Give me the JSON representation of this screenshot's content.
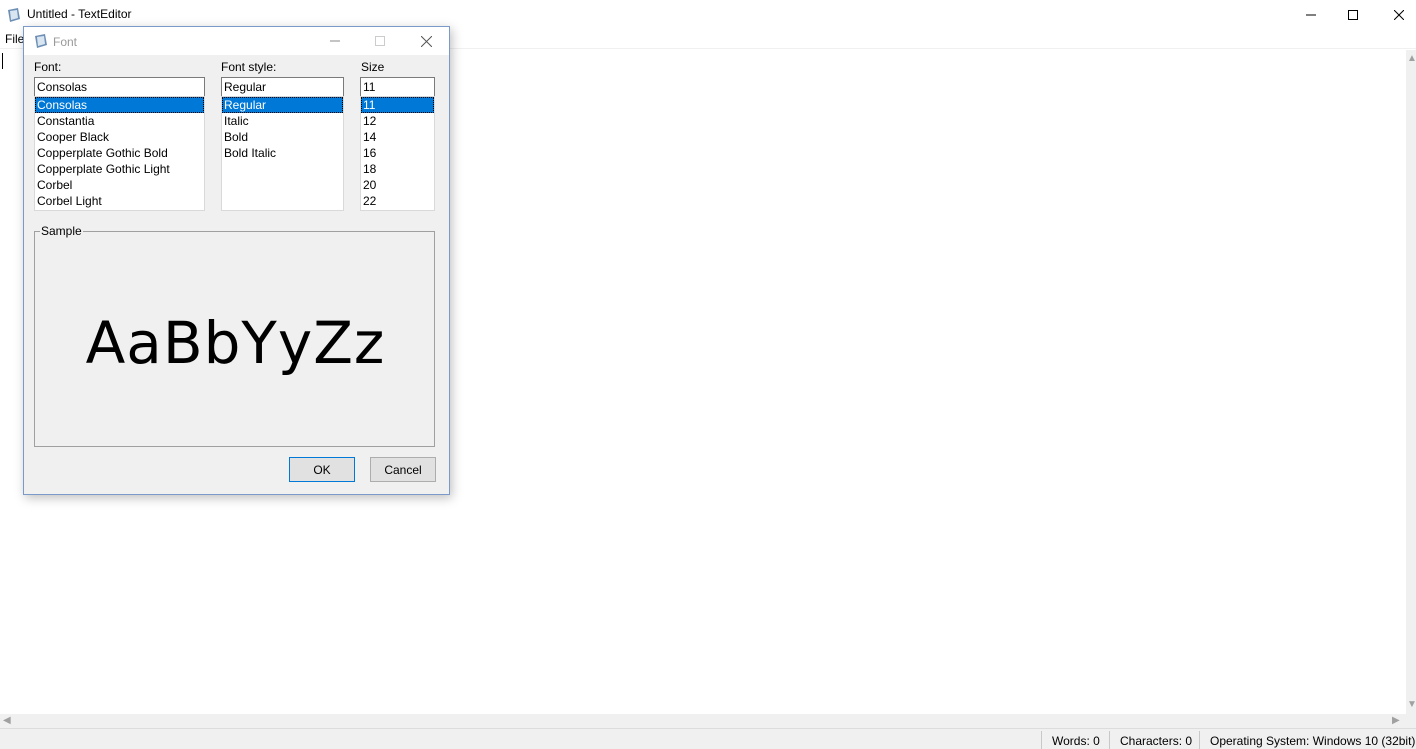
{
  "window": {
    "title": "Untitled - TextEditor",
    "menu": {
      "file": "File"
    }
  },
  "status": {
    "words": "Words: 0",
    "characters": "Characters: 0",
    "os": "Operating System: Windows 10 (32bit)"
  },
  "dialog": {
    "title": "Font",
    "font_label": "Font:",
    "style_label": "Font style:",
    "size_label": "Size",
    "font_value": "Consolas",
    "style_value": "Regular",
    "size_value": "11",
    "fonts": [
      "Consolas",
      "Constantia",
      "Cooper Black",
      "Copperplate Gothic Bold",
      "Copperplate Gothic Light",
      "Corbel",
      "Corbel Light"
    ],
    "styles": [
      "Regular",
      "Italic",
      "Bold",
      "Bold Italic"
    ],
    "sizes": [
      "11",
      "12",
      "14",
      "16",
      "18",
      "20",
      "22"
    ],
    "selected_font": "Consolas",
    "selected_style": "Regular",
    "selected_size": "11",
    "sample_label": "Sample",
    "sample_text": "AaBbYyZz",
    "ok_label": "OK",
    "cancel_label": "Cancel"
  },
  "colors": {
    "selection": "#0078d7",
    "dialog_bg": "#f0f0f0"
  }
}
